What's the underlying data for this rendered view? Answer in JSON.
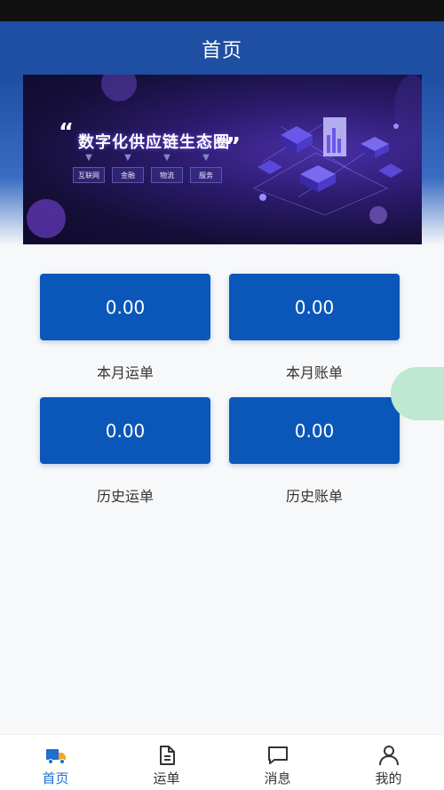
{
  "header": {
    "title": "首页"
  },
  "banner": {
    "title": "数字化供应链生态圈",
    "tags": [
      "互联网",
      "金融",
      "物流",
      "服务"
    ]
  },
  "stats": [
    {
      "value": "0.00",
      "label": "本月运单"
    },
    {
      "value": "0.00",
      "label": "本月账单"
    },
    {
      "value": "0.00",
      "label": "历史运单"
    },
    {
      "value": "0.00",
      "label": "历史账单"
    }
  ],
  "tabbar": {
    "items": [
      {
        "label": "首页",
        "icon": "truck-icon",
        "active": true
      },
      {
        "label": "运单",
        "icon": "document-icon",
        "active": false
      },
      {
        "label": "消息",
        "icon": "message-icon",
        "active": false
      },
      {
        "label": "我的",
        "icon": "user-icon",
        "active": false
      }
    ]
  },
  "colors": {
    "primary": "#1e4fa3",
    "button": "#0a57b9",
    "active_tab": "#1e6fd0"
  }
}
